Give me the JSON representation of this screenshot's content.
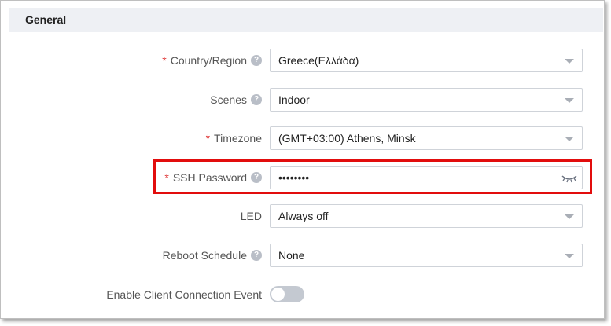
{
  "section": {
    "title": "General"
  },
  "fields": {
    "country": {
      "label": "Country/Region",
      "required": "*",
      "help": "?",
      "value": "Greece(Ελλάδα)"
    },
    "scenes": {
      "label": "Scenes",
      "help": "?",
      "value": "Indoor"
    },
    "timezone": {
      "label": "Timezone",
      "required": "*",
      "value": "(GMT+03:00) Athens, Minsk"
    },
    "ssh_password": {
      "label": "SSH Password",
      "required": "*",
      "help": "?",
      "value": "••••••••"
    },
    "led": {
      "label": "LED",
      "value": "Always off"
    },
    "reboot": {
      "label": "Reboot Schedule",
      "help": "?",
      "value": "None"
    },
    "client_event": {
      "label": "Enable Client Connection Event",
      "enabled": false
    }
  },
  "colors": {
    "required": "#e03b3b",
    "highlight": "#e20d0d",
    "header_bg": "#eef0f4",
    "toggle_off": "#c4c9d1"
  },
  "icons": {
    "help": "help-circle-icon",
    "dropdown": "chevron-down-icon",
    "password_visibility": "eye-closed-icon"
  }
}
